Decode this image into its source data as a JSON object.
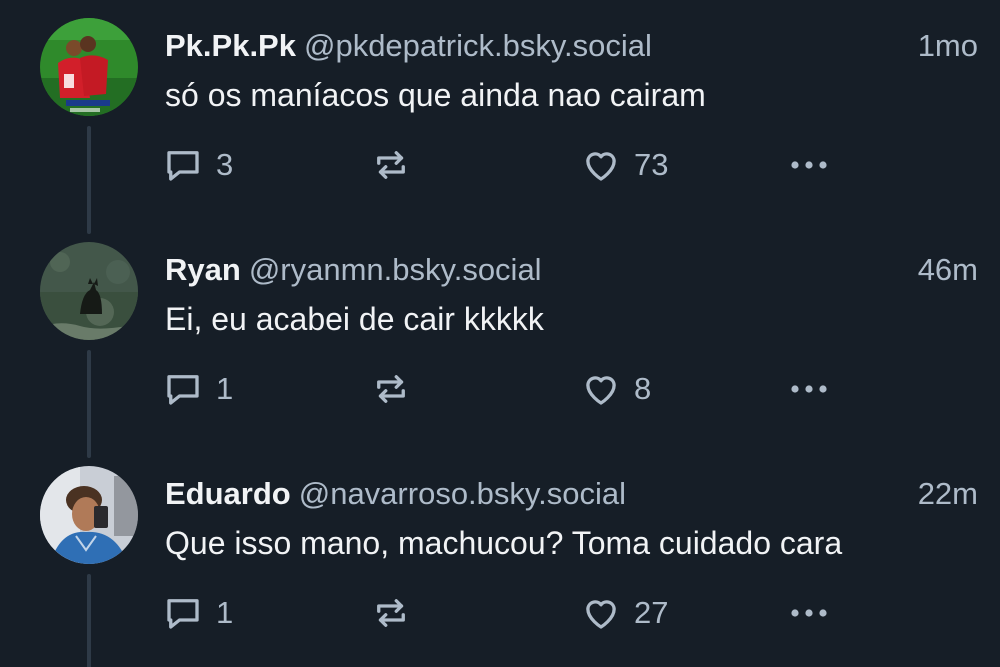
{
  "posts": [
    {
      "display_name": "Pk.Pk.Pk",
      "handle": "@pkdepatrick.bsky.social",
      "timestamp": "1mo",
      "text": "só os maníacos que ainda nao cairam",
      "reply_count": "3",
      "repost_count": "",
      "like_count": "73"
    },
    {
      "display_name": "Ryan",
      "handle": "@ryanmn.bsky.social",
      "timestamp": "46m",
      "text": "Ei, eu acabei de cair kkkkk",
      "reply_count": "1",
      "repost_count": "",
      "like_count": "8"
    },
    {
      "display_name": "Eduardo",
      "handle": "@navarroso.bsky.social",
      "timestamp": "22m",
      "text": "Que isso mano, machucou? Toma cuidado cara",
      "reply_count": "1",
      "repost_count": "",
      "like_count": "27"
    }
  ],
  "icons": {
    "reply": "reply-icon",
    "repost": "repost-icon",
    "like": "heart-icon",
    "more": "more-dots-icon"
  },
  "colors": {
    "background": "#161e27",
    "text": "#f1f3f5",
    "muted": "#aebbc9",
    "thread_line": "#2e3a47"
  }
}
